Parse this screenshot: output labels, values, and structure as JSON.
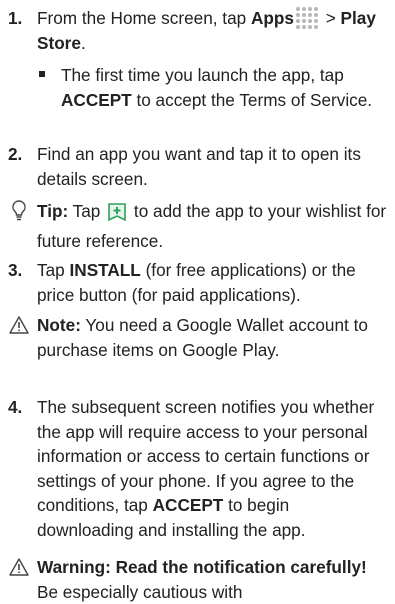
{
  "steps": {
    "s1": {
      "num": "1.",
      "a": "From the Home screen, tap ",
      "b1": "Apps",
      "c": " > ",
      "b2": "Play Store",
      "d": "."
    },
    "s1_sub": {
      "a": "The first time you launch the app, tap ",
      "b": "ACCEPT",
      "c": " to accept the Terms of Service."
    },
    "s2": {
      "num": "2.",
      "text": "Find an app you want and tap it to open its details screen."
    },
    "tip": {
      "label": "Tip:",
      "a": " Tap ",
      "b": " to add the app to your wishlist for future reference."
    },
    "s3": {
      "num": "3.",
      "a": "Tap ",
      "b": "INSTALL",
      "c": " (for free applications) or the price button (for paid applications)."
    },
    "note": {
      "label": "Note:",
      "text": " You need a Google Wallet account to purchase items on Google Play."
    },
    "s4": {
      "num": "4.",
      "a": "The subsequent screen notifies you whether the app will require access to your personal information or access to certain functions or settings of your phone. If you agree to the conditions, tap ",
      "b": "ACCEPT",
      "c": " to begin downloading and installing the app."
    },
    "warning": {
      "label": "Warning: Read the notification carefully!",
      "text": " Be especially cautious with"
    }
  },
  "icons": {
    "apps": "apps-grid-icon",
    "wishlist": "wishlist-add-icon",
    "tip": "lightbulb-icon",
    "note": "warning-triangle-icon",
    "warning": "warning-triangle-icon"
  },
  "colors": {
    "text": "#222222",
    "icon_fill": "#b7b7b7",
    "wishlist_green": "#2fa05a"
  }
}
